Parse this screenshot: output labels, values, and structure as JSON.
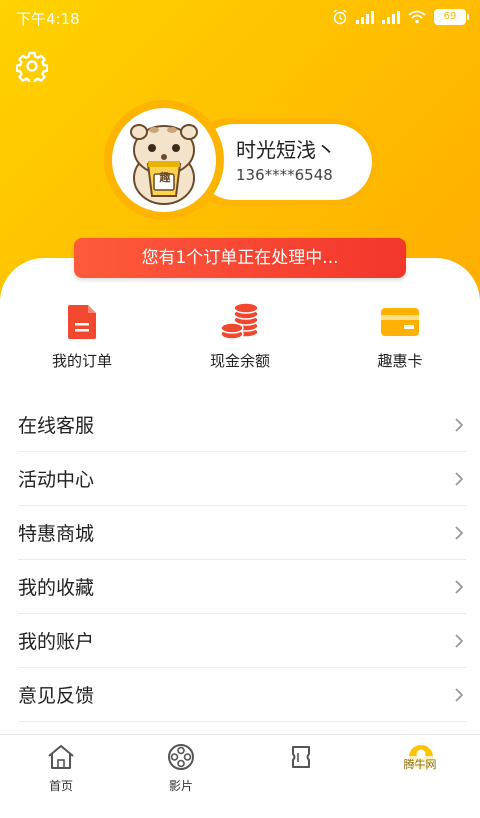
{
  "status_bar": {
    "time": "下午4:18",
    "battery": "69"
  },
  "profile": {
    "name": "时光短浅丶",
    "phone": "136****6548",
    "avatar_label": "趣"
  },
  "notice": "您有1个订单正在处理中...",
  "quick_actions": [
    {
      "label": "我的订单",
      "icon": "order-document-icon"
    },
    {
      "label": "现金余额",
      "icon": "coins-icon"
    },
    {
      "label": "趣惠卡",
      "icon": "card-icon"
    }
  ],
  "menu": [
    {
      "label": "在线客服"
    },
    {
      "label": "活动中心"
    },
    {
      "label": "特惠商城"
    },
    {
      "label": "我的收藏"
    },
    {
      "label": "我的账户"
    },
    {
      "label": "意见反馈"
    }
  ],
  "bottom_nav": [
    {
      "label": "首页",
      "icon": "home-icon"
    },
    {
      "label": "影片",
      "icon": "film-reel-icon"
    },
    {
      "label": "",
      "icon": "ticket-icon"
    },
    {
      "label": "",
      "icon": "profile-icon"
    }
  ],
  "watermark": "腾牛网",
  "colors": {
    "accent": "#ffbe00",
    "notice": "#f2362c",
    "text": "#222222"
  }
}
